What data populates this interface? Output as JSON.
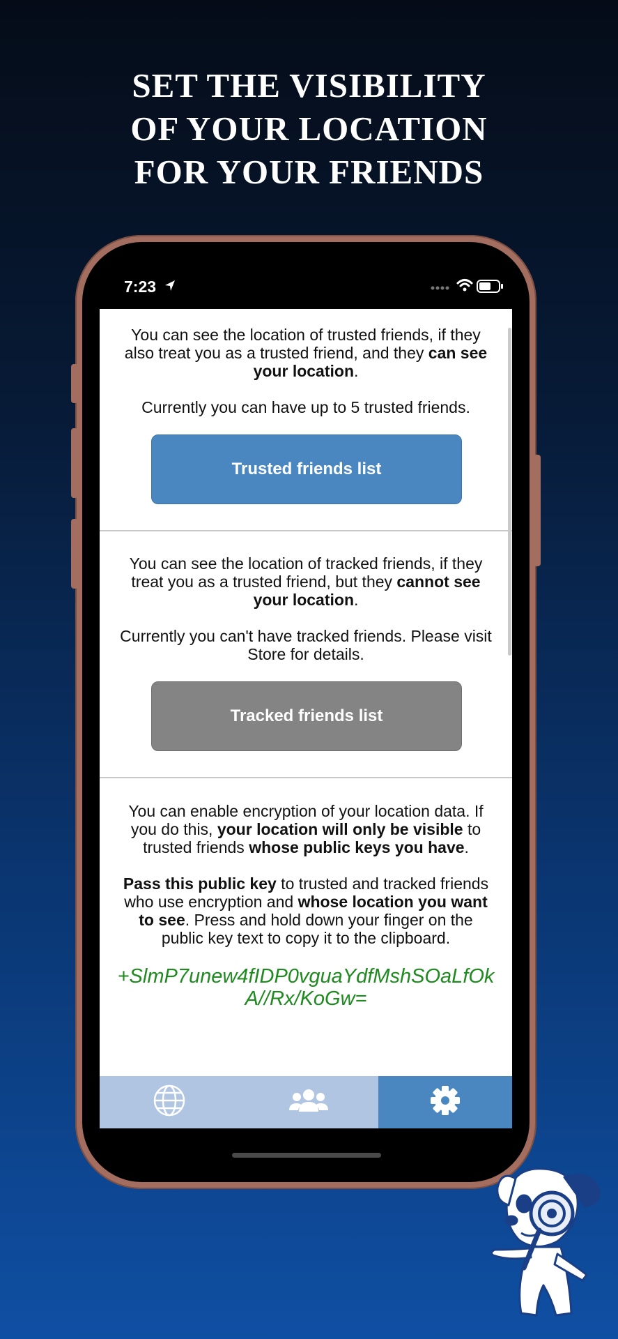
{
  "headline": {
    "line1": "SET THE VISIBILITY",
    "line2": "OF YOUR LOCATION",
    "line3": "FOR YOUR FRIENDS"
  },
  "status_bar": {
    "time": "7:23"
  },
  "trusted": {
    "text_a": "You can see the location of trusted friends, if they also treat you as a trusted friend, and they ",
    "text_b": "can see your location",
    "text_c": ".",
    "limit": "Currently you can have up to 5 trusted friends.",
    "button": "Trusted friends list"
  },
  "tracked": {
    "text_a": "You can see the location of tracked friends, if they treat you as a trusted friend, but they ",
    "text_b": "cannot see your location",
    "text_c": ".",
    "limit": "Currently you can't have tracked friends. Please visit Store for details.",
    "button": "Tracked friends list"
  },
  "encryption": {
    "p1_a": "You can enable encryption of your location data. If you do this, ",
    "p1_b": "your location will only be visible",
    "p1_c": " to trusted friends ",
    "p1_d": "whose public keys you have",
    "p1_e": ".",
    "p2_a": "Pass this public key",
    "p2_b": " to trusted and tracked friends who use encryption and ",
    "p2_c": "whose location you want to see",
    "p2_d": ". Press and hold down your finger on the public key text to copy it to the clipboard.",
    "public_key": "+SlmP7unew4fIDP0vguaYdfMshSOaLfOkA//Rx/KoGw="
  },
  "tabbar": {
    "tabs": [
      {
        "icon": "globe-icon",
        "active": false
      },
      {
        "icon": "friends-icon",
        "active": false
      },
      {
        "icon": "gear-icon",
        "active": true
      }
    ]
  },
  "colors": {
    "accent_blue": "#4a87c1",
    "disabled_gray": "#848484",
    "key_green": "#1f8a1f",
    "tab_inactive": "#afc5e2",
    "phone_frame": "#a36e5f"
  }
}
